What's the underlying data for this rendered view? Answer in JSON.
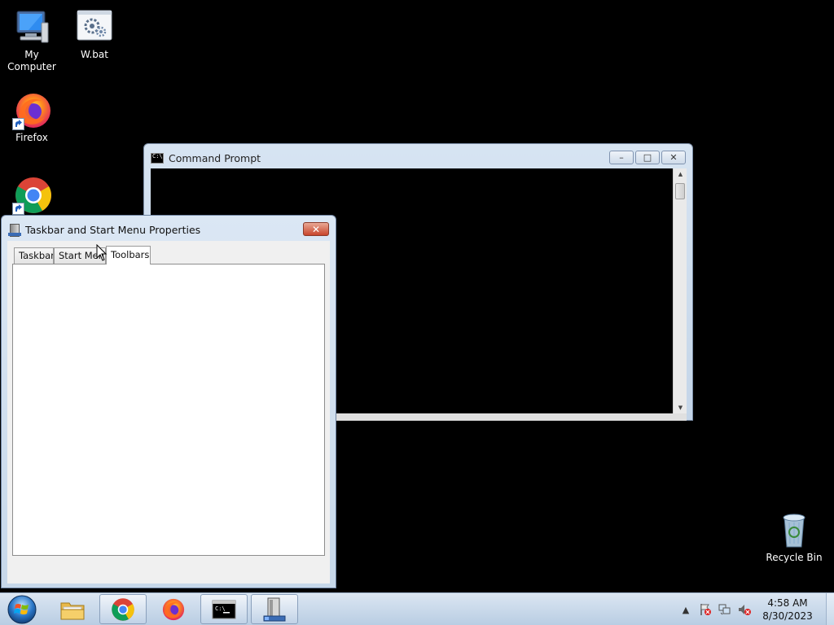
{
  "desktop": {
    "icons": [
      {
        "label": "My Computer",
        "icon": "computer-icon"
      },
      {
        "label": "W.bat",
        "icon": "batch-file-icon"
      },
      {
        "label": "Firefox",
        "icon": "firefox-icon"
      },
      {
        "label": "",
        "icon": "chrome-icon"
      }
    ],
    "recycle_bin": {
      "label": "Recycle Bin",
      "icon": "recycle-bin-icon"
    }
  },
  "cmd_window": {
    "title": "Command Prompt",
    "minimize": "–",
    "maximize": "□",
    "close": "✕"
  },
  "dialog": {
    "title": "Taskbar and Start Menu Properties",
    "close": "✕",
    "tabs": [
      {
        "label": "Taskbar",
        "active": false
      },
      {
        "label": "Start Menu",
        "active": false
      },
      {
        "label": "Toolbars",
        "active": true
      }
    ]
  },
  "taskbar": {
    "items": [
      "start-orb",
      "explorer-icon",
      "chrome-icon",
      "firefox-icon",
      "cmd-icon",
      "taskbar-properties-icon"
    ],
    "clock": {
      "time": "4:58 AM",
      "date": "8/30/2023"
    }
  },
  "colors": {
    "desktop_bg": "#000000",
    "taskbar_bg": "#c9d9ea",
    "dialog_close": "#c8452b"
  }
}
